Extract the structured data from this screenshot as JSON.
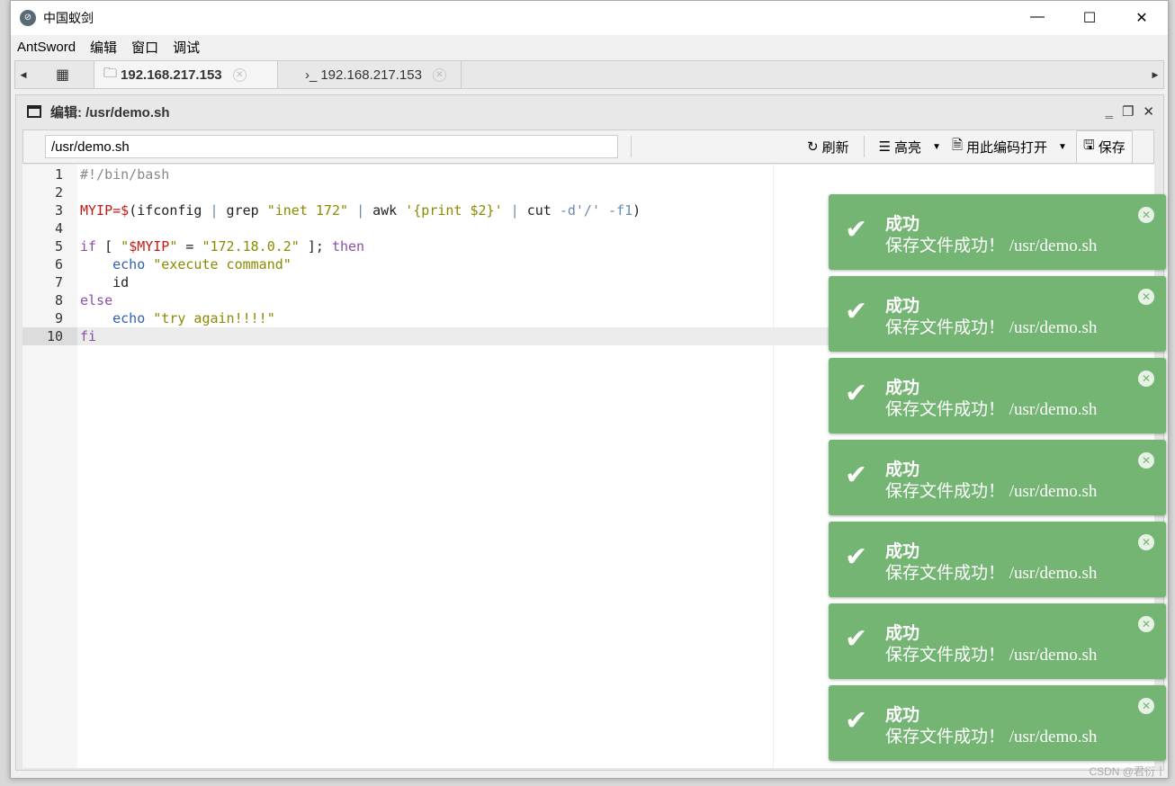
{
  "window": {
    "title": "中国蚁剑",
    "minimize": "—",
    "maximize": "☐",
    "close": "✕"
  },
  "menu": [
    "AntSword",
    "编辑",
    "窗口",
    "调试"
  ],
  "tabs": [
    {
      "label": "192.168.217.153",
      "icon": "folder-icon",
      "glyph": "🗀"
    },
    {
      "label": "192.168.217.153",
      "icon": "terminal-icon",
      "glyph": "›_"
    }
  ],
  "panel": {
    "title": "编辑: /usr/demo.sh",
    "path": "/usr/demo.sh"
  },
  "toolbar": {
    "refresh": "刷新",
    "highlight": "高亮",
    "open_with_encoding": "用此编码打开",
    "save": "保存"
  },
  "code": [
    [
      [
        "#!/bin/bash",
        "comment"
      ]
    ],
    [],
    [
      [
        "MYIP=$",
        "var"
      ],
      [
        "(ifconfig ",
        ""
      ],
      [
        "|",
        "op"
      ],
      [
        " grep ",
        ""
      ],
      [
        "\"inet 172\"",
        "str"
      ],
      [
        " ",
        ""
      ],
      [
        "|",
        "op"
      ],
      [
        " awk ",
        ""
      ],
      [
        "'{print $2}'",
        "str"
      ],
      [
        " ",
        ""
      ],
      [
        "|",
        "op"
      ],
      [
        " cut ",
        ""
      ],
      [
        "-d'/' -f1",
        "op"
      ],
      [
        ")",
        ""
      ]
    ],
    [],
    [
      [
        "if",
        "kw"
      ],
      [
        " [ ",
        ""
      ],
      [
        "\"",
        "str"
      ],
      [
        "$MYIP",
        "var"
      ],
      [
        "\"",
        "str"
      ],
      [
        " = ",
        ""
      ],
      [
        "\"172.18.0.2\"",
        "str"
      ],
      [
        " ]; ",
        ""
      ],
      [
        "then",
        "kw"
      ]
    ],
    [
      [
        "    ",
        ""
      ],
      [
        "echo",
        "cmd"
      ],
      [
        " ",
        ""
      ],
      [
        "\"execute command\"",
        "str"
      ]
    ],
    [
      [
        "    id",
        ""
      ]
    ],
    [
      [
        "else",
        "kw"
      ]
    ],
    [
      [
        "    ",
        ""
      ],
      [
        "echo",
        "cmd"
      ],
      [
        " ",
        ""
      ],
      [
        "\"try again!!!!\"",
        "str"
      ]
    ],
    [
      [
        "fi",
        "kw"
      ]
    ]
  ],
  "current_line": 10,
  "toasts": [
    {
      "title": "成功",
      "message": "保存文件成功！ /usr/demo.sh"
    },
    {
      "title": "成功",
      "message": "保存文件成功！ /usr/demo.sh"
    },
    {
      "title": "成功",
      "message": "保存文件成功！ /usr/demo.sh"
    },
    {
      "title": "成功",
      "message": "保存文件成功！ /usr/demo.sh"
    },
    {
      "title": "成功",
      "message": "保存文件成功！ /usr/demo.sh"
    },
    {
      "title": "成功",
      "message": "保存文件成功！ /usr/demo.sh"
    },
    {
      "title": "成功",
      "message": "保存文件成功！ /usr/demo.sh"
    }
  ],
  "colors": {
    "toast_success": "#74b574"
  },
  "watermark": "CSDN @君衍丨"
}
